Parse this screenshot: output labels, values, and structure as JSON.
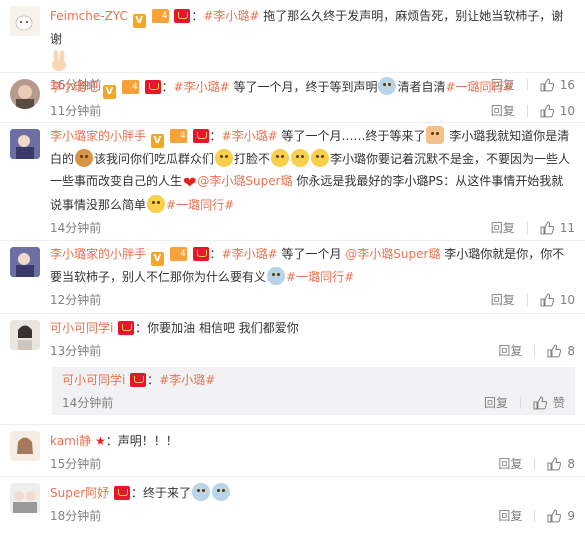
{
  "comments": [
    {
      "name": "Feimche-ZYC",
      "pre": "：",
      "topic": "#李小璐#",
      "body": " 拖了那么久终于发声明，麻烦告死，别让她当软柿子，谢谢",
      "time": "16分钟前",
      "reply": "回复",
      "likes": "16"
    },
    {
      "name": "李小璐吧",
      "pre": "：",
      "topic": "#李小璐#",
      "body": " 等了一个月，终于等到声明",
      "body2": "清者自清",
      "topic2": "#一璐同行#",
      "time": "11分钟前",
      "reply": "回复",
      "likes": "10"
    },
    {
      "name": "李小璐家的小胖手",
      "pre": "：",
      "topic": "#李小璐#",
      "body": " 等了一个月……终于等来了",
      "body2": " 李小璐我就知道你是清白的",
      "body3": "该我问你们吃瓜群众们",
      "body4": "打脸不",
      "body5": "李小璐你要记着沉默不是金，不要因为一些人一些事而改变自己的人生",
      "mention": "@李小璐Super璐",
      "body6": " 你永远是我最好的李小璐PS：从这件事情开始我就说事情没那么简单",
      "topic2": "#一璐同行#",
      "time": "14分钟前",
      "reply": "回复",
      "likes": "11"
    },
    {
      "name": "李小璐家的小胖手",
      "pre": "：",
      "topic": "#李小璐#",
      "body": " 等了一个月 ",
      "mention": "@李小璐Super璐",
      "body2": " 李小璐你就是你，你不要当软柿子，别人不仁那你为什么要有义",
      "topic2": "#一璐同行#",
      "time": "12分钟前",
      "reply": "回复",
      "likes": "10"
    },
    {
      "name": "可小可同学i",
      "pre": "：你要加油 相信吧 我们都爱你",
      "time": "13分钟前",
      "reply": "回复",
      "likes": "8",
      "sub": {
        "name": "可小可同学i",
        "pre": "：",
        "topic": "#李小璐#",
        "time": "14分钟前",
        "reply": "回复",
        "like_label": "赞"
      }
    },
    {
      "name": "kami静",
      "pre": "：声明！！！",
      "time": "15分钟前",
      "reply": "回复",
      "likes": "8"
    },
    {
      "name": "Super阿妤",
      "pre": "：终于来了",
      "time": "18分钟前",
      "reply": "回复",
      "likes": "9"
    }
  ],
  "colors": {
    "accent": "#eb7350",
    "meta": "#808080",
    "badge_red": "#e6162d",
    "badge_orange": "#f5a623"
  },
  "icons": {
    "like": "thumbs-up-icon",
    "vip": "vip-badge-icon",
    "verified": "verified-v-icon",
    "fan": "fan-level-icon",
    "star": "star-badge-icon"
  }
}
